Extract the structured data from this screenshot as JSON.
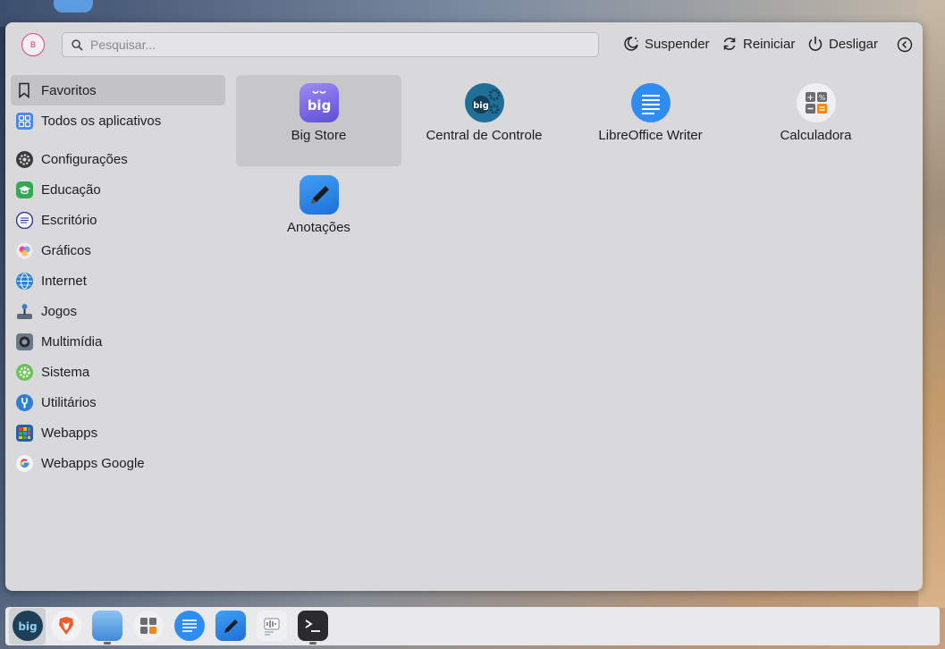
{
  "header": {
    "avatar_initial": "B",
    "search_placeholder": "Pesquisar...",
    "suspend_label": "Suspender",
    "restart_label": "Reiniciar",
    "shutdown_label": "Desligar"
  },
  "sidebar": {
    "items": [
      {
        "label": "Favoritos",
        "icon": "bookmark-icon"
      },
      {
        "label": "Todos os aplicativos",
        "icon": "grid-icon"
      },
      {
        "label": "Configurações",
        "icon": "settings-icon"
      },
      {
        "label": "Educação",
        "icon": "education-icon"
      },
      {
        "label": "Escritório",
        "icon": "office-icon"
      },
      {
        "label": "Gráficos",
        "icon": "graphics-icon"
      },
      {
        "label": "Internet",
        "icon": "internet-icon"
      },
      {
        "label": "Jogos",
        "icon": "games-icon"
      },
      {
        "label": "Multimídia",
        "icon": "multimedia-icon"
      },
      {
        "label": "Sistema",
        "icon": "system-icon"
      },
      {
        "label": "Utilitários",
        "icon": "utilities-icon"
      },
      {
        "label": "Webapps",
        "icon": "webapps-icon"
      },
      {
        "label": "Webapps Google",
        "icon": "google-icon"
      }
    ],
    "selected": "Favoritos"
  },
  "favorites": [
    {
      "label": "Big Store",
      "icon": "big-store-icon"
    },
    {
      "label": "Central de Controle",
      "icon": "control-center-icon"
    },
    {
      "label": "LibreOffice Writer",
      "icon": "libreoffice-writer-icon"
    },
    {
      "label": "Calculadora",
      "icon": "calculator-icon"
    },
    {
      "label": "Anotações",
      "icon": "notes-icon"
    }
  ],
  "dock": {
    "items": [
      "big-launcher-icon",
      "brave-browser-icon",
      "file-manager-icon",
      "calculator-icon",
      "writer-icon",
      "notes-icon",
      "audio-recorder-icon",
      "terminal-icon"
    ]
  },
  "colors": {
    "menu_bg": "#d9d9db",
    "selection": "#c3c3c6",
    "accent_blue": "#2f8cf0"
  }
}
